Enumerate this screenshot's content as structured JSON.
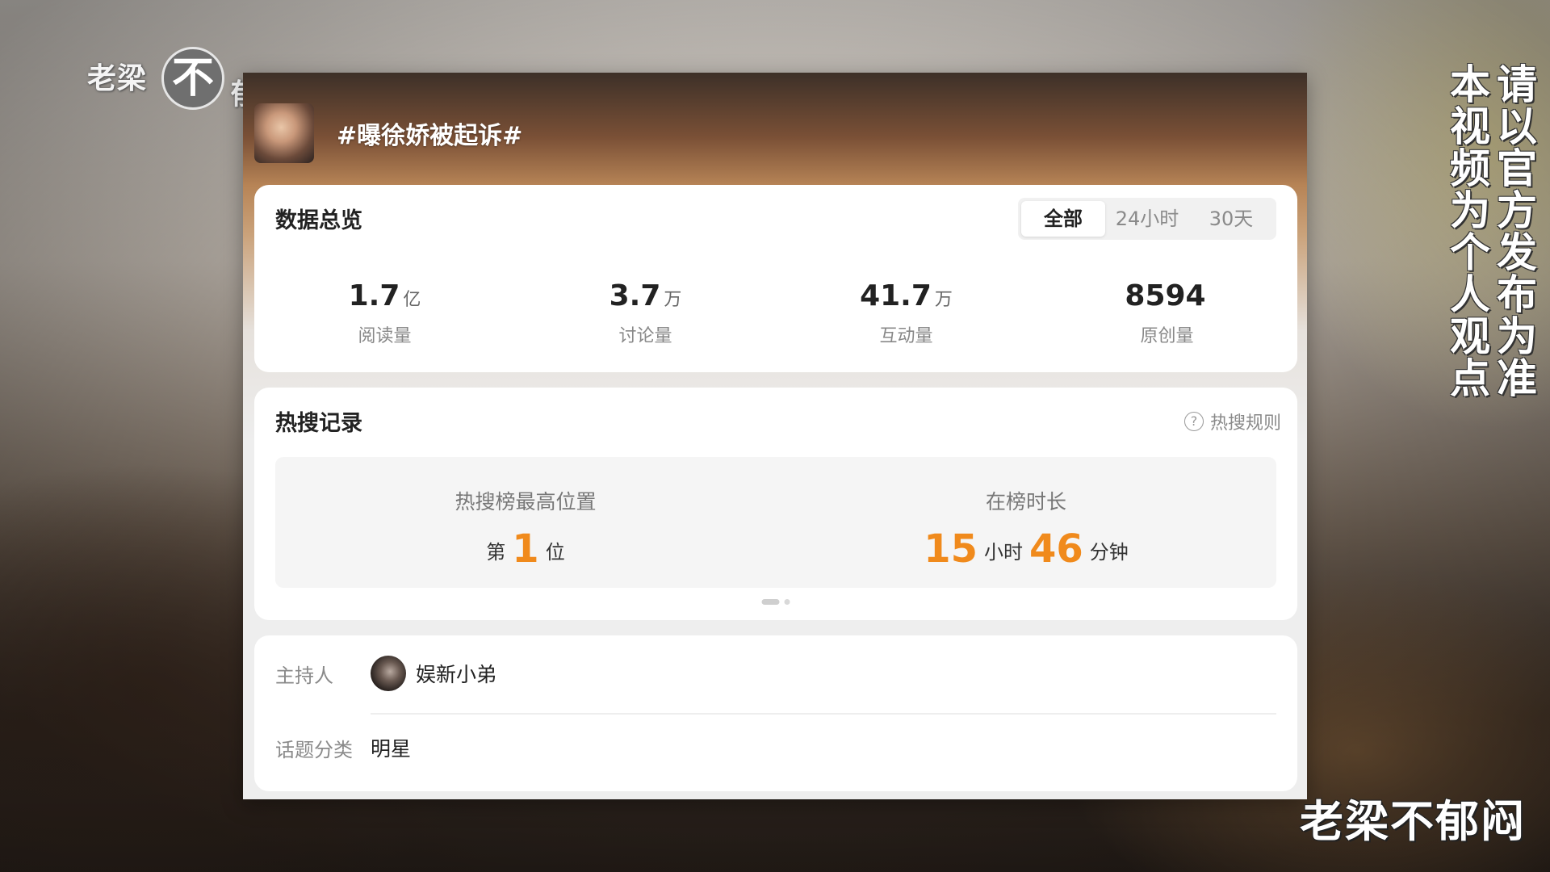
{
  "overlay": {
    "logo_part1": "老梁",
    "logo_circle": "不",
    "logo_part2": "郁闷",
    "caption_col1": "请以官方发布为准",
    "caption_col2": "本视频为个人观点",
    "watermark": "老梁不郁闷"
  },
  "topic": {
    "title": "#曝徐娇被起诉#"
  },
  "overview": {
    "title": "数据总览",
    "tabs": [
      {
        "label": "全部",
        "active": true
      },
      {
        "label": "24小时",
        "active": false
      },
      {
        "label": "30天",
        "active": false
      }
    ],
    "stats": [
      {
        "value": "1.7",
        "unit": "亿",
        "label": "阅读量"
      },
      {
        "value": "3.7",
        "unit": "万",
        "label": "讨论量"
      },
      {
        "value": "41.7",
        "unit": "万",
        "label": "互动量"
      },
      {
        "value": "8594",
        "unit": "",
        "label": "原创量"
      }
    ]
  },
  "hot_search": {
    "title": "热搜记录",
    "rules_label": "热搜规则",
    "help_icon": "question-circle-icon",
    "peak": {
      "label": "热搜榜最高位置",
      "prefix": "第",
      "rank": "1",
      "suffix": "位"
    },
    "duration": {
      "label": "在榜时长",
      "hours": "15",
      "hours_unit": "小时",
      "minutes": "46",
      "minutes_unit": "分钟"
    }
  },
  "info": {
    "host_label": "主持人",
    "host_name": "娱新小弟",
    "category_label": "话题分类",
    "category_value": "明星"
  },
  "colors": {
    "accent_orange": "#f08a1c",
    "card_bg": "#ffffff"
  }
}
